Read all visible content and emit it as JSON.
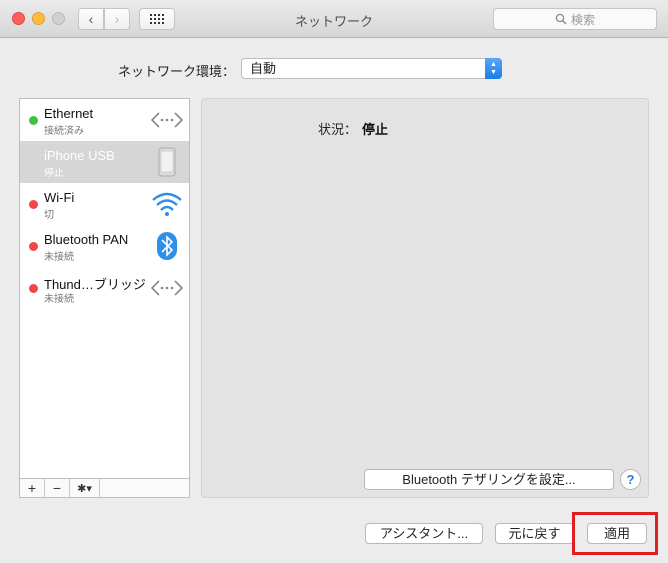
{
  "window": {
    "title": "ネットワーク",
    "search_placeholder": "検索"
  },
  "location": {
    "label": "ネットワーク環境：",
    "value": "自動"
  },
  "services": [
    {
      "name": "Ethernet",
      "status": "接続済み",
      "dot": "green",
      "icon": "ethernet-icon",
      "selected": false
    },
    {
      "name": "iPhone USB",
      "status": "停止",
      "dot": "none",
      "icon": "iphone-icon",
      "selected": true
    },
    {
      "name": "Wi-Fi",
      "status": "切",
      "dot": "red",
      "icon": "wifi-icon",
      "selected": false
    },
    {
      "name": "Bluetooth PAN",
      "status": "未接続",
      "dot": "red",
      "icon": "bluetooth-icon",
      "selected": false
    },
    {
      "name": "Thund…ブリッジ",
      "status": "未接続",
      "dot": "red",
      "icon": "ethernet-icon",
      "selected": false
    }
  ],
  "list_toolbar": {
    "add": "+",
    "remove": "−",
    "action": "✱▾"
  },
  "detail": {
    "status_label": "状況：",
    "status_value": "停止",
    "bluetooth_button": "Bluetooth テザリングを設定...",
    "help": "?"
  },
  "buttons": {
    "assistant": "アシスタント...",
    "revert": "元に戻す",
    "apply": "適用"
  },
  "colors": {
    "accent": "#1c7be8",
    "status_connected": "#3fc33f",
    "status_disconnected": "#f2454a",
    "highlight": "#e02020"
  }
}
